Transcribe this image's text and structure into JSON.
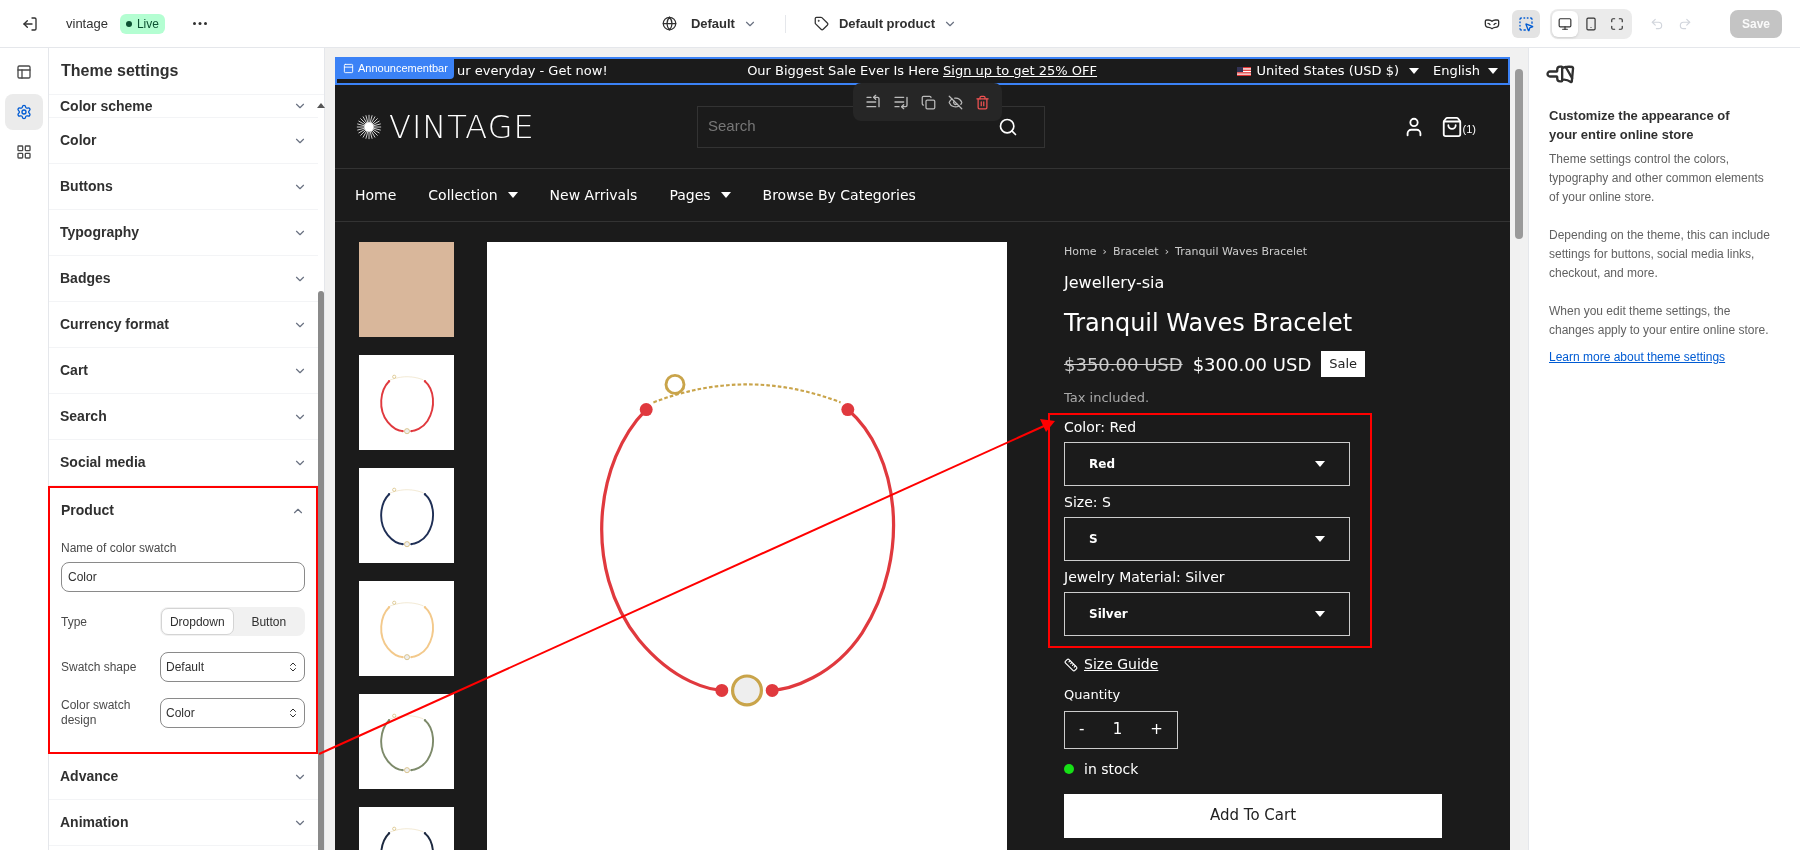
{
  "topbar": {
    "store_name": "vintage",
    "status": "Live",
    "theme": "Default",
    "template": "Default product",
    "tools": [
      {
        "kind": "incognito",
        "selected": false
      },
      {
        "kind": "inspect",
        "selected": true
      }
    ],
    "devices": [
      {
        "kind": "desktop",
        "selected": true
      },
      {
        "kind": "mobile",
        "selected": false
      },
      {
        "kind": "fullwidth",
        "selected": false
      }
    ],
    "undo_disabled": true,
    "redo_disabled": true,
    "save": {
      "label": "Save",
      "disabled": true
    }
  },
  "rail": [
    {
      "kind": "sections",
      "selected": false
    },
    {
      "kind": "settings",
      "selected": true
    },
    {
      "kind": "apps",
      "selected": false
    }
  ],
  "sidebar": {
    "title": "Theme settings",
    "items": [
      {
        "label": "Color scheme",
        "expanded": false
      },
      {
        "label": "Color",
        "expanded": false
      },
      {
        "label": "Buttons",
        "expanded": false
      },
      {
        "label": "Typography",
        "expanded": false
      },
      {
        "label": "Badges",
        "expanded": false
      },
      {
        "label": "Currency format",
        "expanded": false
      },
      {
        "label": "Cart",
        "expanded": false
      },
      {
        "label": "Search",
        "expanded": false
      },
      {
        "label": "Social media",
        "expanded": false
      },
      {
        "label": "Product",
        "expanded": true
      },
      {
        "label": "Advance",
        "expanded": false
      },
      {
        "label": "Animation",
        "expanded": false
      }
    ],
    "product_settings": {
      "name_label": "Name of color swatch",
      "name_value": "Color",
      "type_label": "Type",
      "type_options": [
        {
          "label": "Dropdown",
          "selected": true
        },
        {
          "label": "Button",
          "selected": false
        }
      ],
      "shape_label": "Swatch shape",
      "shape_value": "Default",
      "design_label": "Color swatch design",
      "design_value": "Color"
    }
  },
  "preview": {
    "announcement": {
      "section_label": "Announcementbar",
      "left_text": "ur everyday - Get now!",
      "message": "Our Biggest Sale Ever Is Here",
      "link": "Sign up to get 25% OFF",
      "currency": "United States (USD $)",
      "language": "English"
    },
    "header": {
      "logo": "VINTAGE",
      "search_placeholder": "Search",
      "cart_count": "(1)"
    },
    "nav": [
      {
        "label": "Home",
        "has_menu": false
      },
      {
        "label": "Collection",
        "has_menu": true
      },
      {
        "label": "New Arrivals",
        "has_menu": false
      },
      {
        "label": "Pages",
        "has_menu": true
      },
      {
        "label": "Browse By Categories",
        "has_menu": false
      }
    ],
    "product": {
      "thumbnails": [
        {
          "kind": "photo"
        },
        {
          "kind": "bracelet",
          "color": "#e0393e"
        },
        {
          "kind": "bracelet",
          "color": "#1f2f55"
        },
        {
          "kind": "bracelet",
          "color": "#f3c98b"
        },
        {
          "kind": "bracelet",
          "color": "#7d8a6a"
        },
        {
          "kind": "bracelet",
          "color": "#1e2a40"
        }
      ],
      "breadcrumb": [
        "Home",
        "Bracelet",
        "Tranquil Waves Bracelet"
      ],
      "breadcrumb_separator": "›",
      "vendor": "Jewellery-sia",
      "title": "Tranquil Waves Bracelet",
      "compare_price": "$350.00 USD",
      "price": "$300.00 USD",
      "badge": "Sale",
      "tax_note": "Tax included.",
      "options": [
        {
          "label": "Color: Red",
          "value": "Red"
        },
        {
          "label": "Size: S",
          "value": "S"
        },
        {
          "label": "Jewelry Material: Silver",
          "value": "Silver"
        }
      ],
      "size_guide": "Size Guide",
      "quantity_label": "Quantity",
      "qty_minus": "-",
      "quantity": "1",
      "qty_plus": "+",
      "in_stock": true,
      "stock_text": "in stock",
      "add_to_cart": "Add To Cart"
    }
  },
  "help_panel": {
    "heading": "Customize the appearance of your entire online store",
    "paragraphs": [
      "Theme settings control the colors, typography and other common elements of your online store.",
      "Depending on the theme, this can include settings for buttons, social media links, checkout, and more.",
      "When you edit theme settings, the changes apply to your entire online store."
    ],
    "link": "Learn more about theme settings"
  }
}
